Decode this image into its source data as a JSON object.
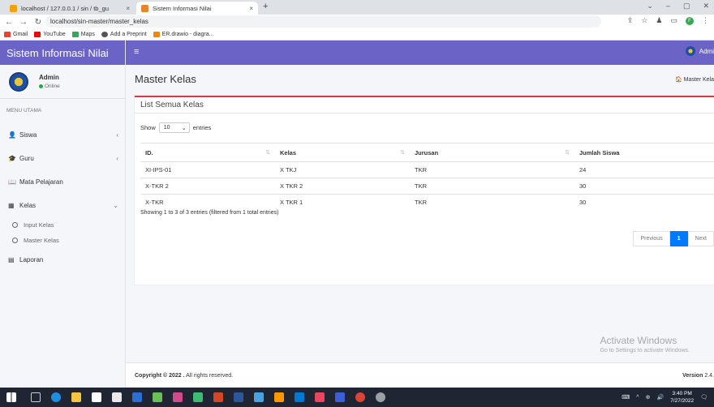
{
  "browser": {
    "tabs": [
      {
        "label": "localhost / 127.0.0.1 / sin / tb_gu",
        "active": false
      },
      {
        "label": "Sistem Informasi Nilai",
        "active": true
      }
    ],
    "tab_close": "×",
    "new_tab": "+",
    "url": "localhost/sin-master/master_kelas",
    "bookmarks": [
      "Gmail",
      "YouTube",
      "Maps",
      "Add a Preprint",
      "ER.drawio - diagra..."
    ],
    "profile_initial": "F"
  },
  "app": {
    "brand": "Sistem Informasi Nilai",
    "user": {
      "name": "Admin",
      "status": "Online"
    },
    "nav_user": "Admi",
    "menu_header": "MENU UTAMA",
    "menu": [
      {
        "label": "Siswa",
        "caret": "‹"
      },
      {
        "label": "Guru",
        "caret": "‹"
      },
      {
        "label": "Mata Pelajaran",
        "caret": ""
      },
      {
        "label": "Kelas",
        "caret": "⌄"
      }
    ],
    "submenu": [
      "Input Kelas",
      "Master Kelas"
    ],
    "menu_last": "Laporan"
  },
  "page": {
    "title": "Master Kelas",
    "breadcrumb": "Master Kela",
    "card_title": "List Semua Kelas",
    "show_label": "Show",
    "entries_value": "10",
    "entries_label": "entries",
    "columns": [
      "ID.",
      "Kelas",
      "Jurusan",
      "Jumlah Siswa"
    ],
    "rows": [
      [
        "XI-IPS-01",
        "X TKJ",
        "TKR",
        "24"
      ],
      [
        "X-TKR 2",
        "X TKR 2",
        "TKR",
        "30"
      ],
      [
        "X-TKR",
        "X TKR 1",
        "TKR",
        "30"
      ]
    ],
    "info": "Showing 1 to 3 of 3 entries (filtered from 1 total entries)",
    "pager": {
      "previous": "Previous",
      "current": "1",
      "next": "Next"
    },
    "footer_copyright": "Copyright © 2022 .",
    "footer_rights": " All rights reserved.",
    "footer_version_label": "Version",
    "footer_version": "2.4.",
    "watermark_title": "Activate Windows",
    "watermark_sub": "Go to Settings to activate Windows."
  },
  "taskbar": {
    "time": "3:40 PM",
    "date": "7/27/2022"
  },
  "colors": {
    "primary": "#6c63c7",
    "card_accent": "#dc3545",
    "pager_active": "#007bff",
    "online": "#28a745"
  }
}
